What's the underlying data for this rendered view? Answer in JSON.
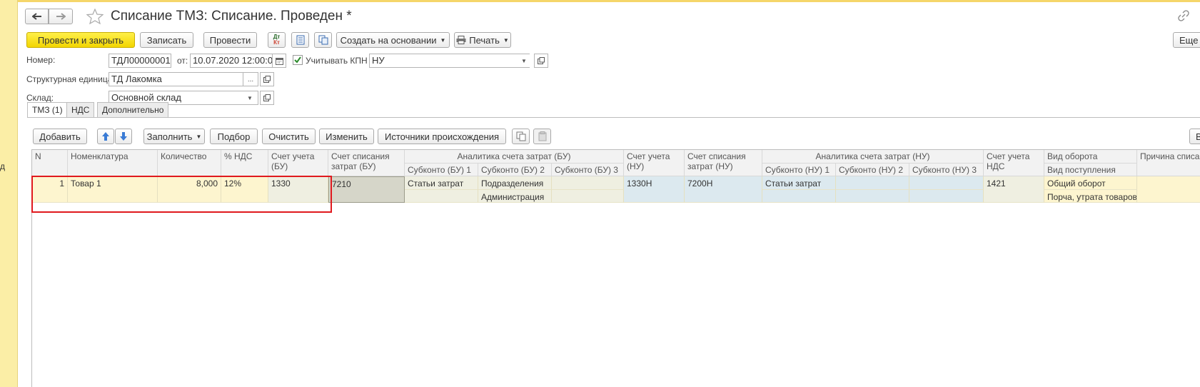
{
  "window": {
    "title": "Списание ТМЗ: Списание. Проведен *",
    "left_cut_text": "д"
  },
  "toolbar": {
    "post_close": "Провести и закрыть",
    "save": "Записать",
    "post": "Провести",
    "dtkt_top": "Дт",
    "dtkt_bottom": "Кт",
    "create_based": "Создать на основании",
    "print": "Печать",
    "more": "Еще"
  },
  "form": {
    "number_label": "Номер:",
    "number_value": "ТДЛ00000001",
    "date_label": "от:",
    "date_value": "10.07.2020 12:00:0",
    "kpn_label": "Учитывать КПН",
    "kpn_checked": true,
    "kpn_value": "НУ",
    "unit_label": "Структурная единица:",
    "unit_value": "ТД Лакомка",
    "warehouse_label": "Склад:",
    "warehouse_value": "Основной склад",
    "ellipsis": "..."
  },
  "tabs": [
    {
      "label": "ТМЗ (1)",
      "active": true
    },
    {
      "label": "НДС",
      "active": false
    },
    {
      "label": "Дополнительно",
      "active": false
    }
  ],
  "table_toolbar": {
    "add": "Добавить",
    "fill": "Заполнить",
    "pick": "Подбор",
    "clear": "Очистить",
    "edit": "Изменить",
    "sources": "Источники происхождения",
    "cut_right": "В"
  },
  "table": {
    "headers": {
      "n": "N",
      "nomenclature": "Номенклатура",
      "qty": "Количество",
      "vat": "% НДС",
      "acc_bu": "Счет учета (БУ)",
      "writeoff_bu": "Счет списания затрат (БУ)",
      "analytics_bu": "Аналитика счета затрат (БУ)",
      "sub_bu1": "Субконто (БУ) 1",
      "sub_bu2": "Субконто (БУ) 2",
      "sub_bu3": "Субконто (БУ) 3",
      "acc_nu": "Счет учета (НУ)",
      "writeoff_nu": "Счет списания затрат (НУ)",
      "analytics_nu": "Аналитика счета затрат (НУ)",
      "sub_nu1": "Субконто (НУ) 1",
      "sub_nu2": "Субконто (НУ) 2",
      "sub_nu3": "Субконто (НУ) 3",
      "acc_vat": "Счет учета НДС",
      "turnover": "Вид оборота",
      "receipt_type": "Вид поступления",
      "reason": "Причина списан"
    },
    "rows": [
      {
        "n": "1",
        "nomenclature": "Товар 1",
        "qty": "8,000",
        "vat": "12%",
        "acc_bu": "1330",
        "writeoff_bu": "7210",
        "sub_bu1": "Статьи затрат",
        "sub_bu2": "Подразделения",
        "sub_bu2_second": "Администрация",
        "acc_nu": "1330Н",
        "writeoff_nu": "7200Н",
        "sub_nu1": "Статьи затрат",
        "acc_vat": "1421",
        "turnover": "Общий оборот",
        "receipt_type": "Порча, утрата товаров"
      }
    ]
  },
  "colors": {
    "primary_button": "#f2d500",
    "row_yellow": "#fdf5cf",
    "row_blue": "#dce9ef",
    "highlight_box": "#e0191e"
  }
}
